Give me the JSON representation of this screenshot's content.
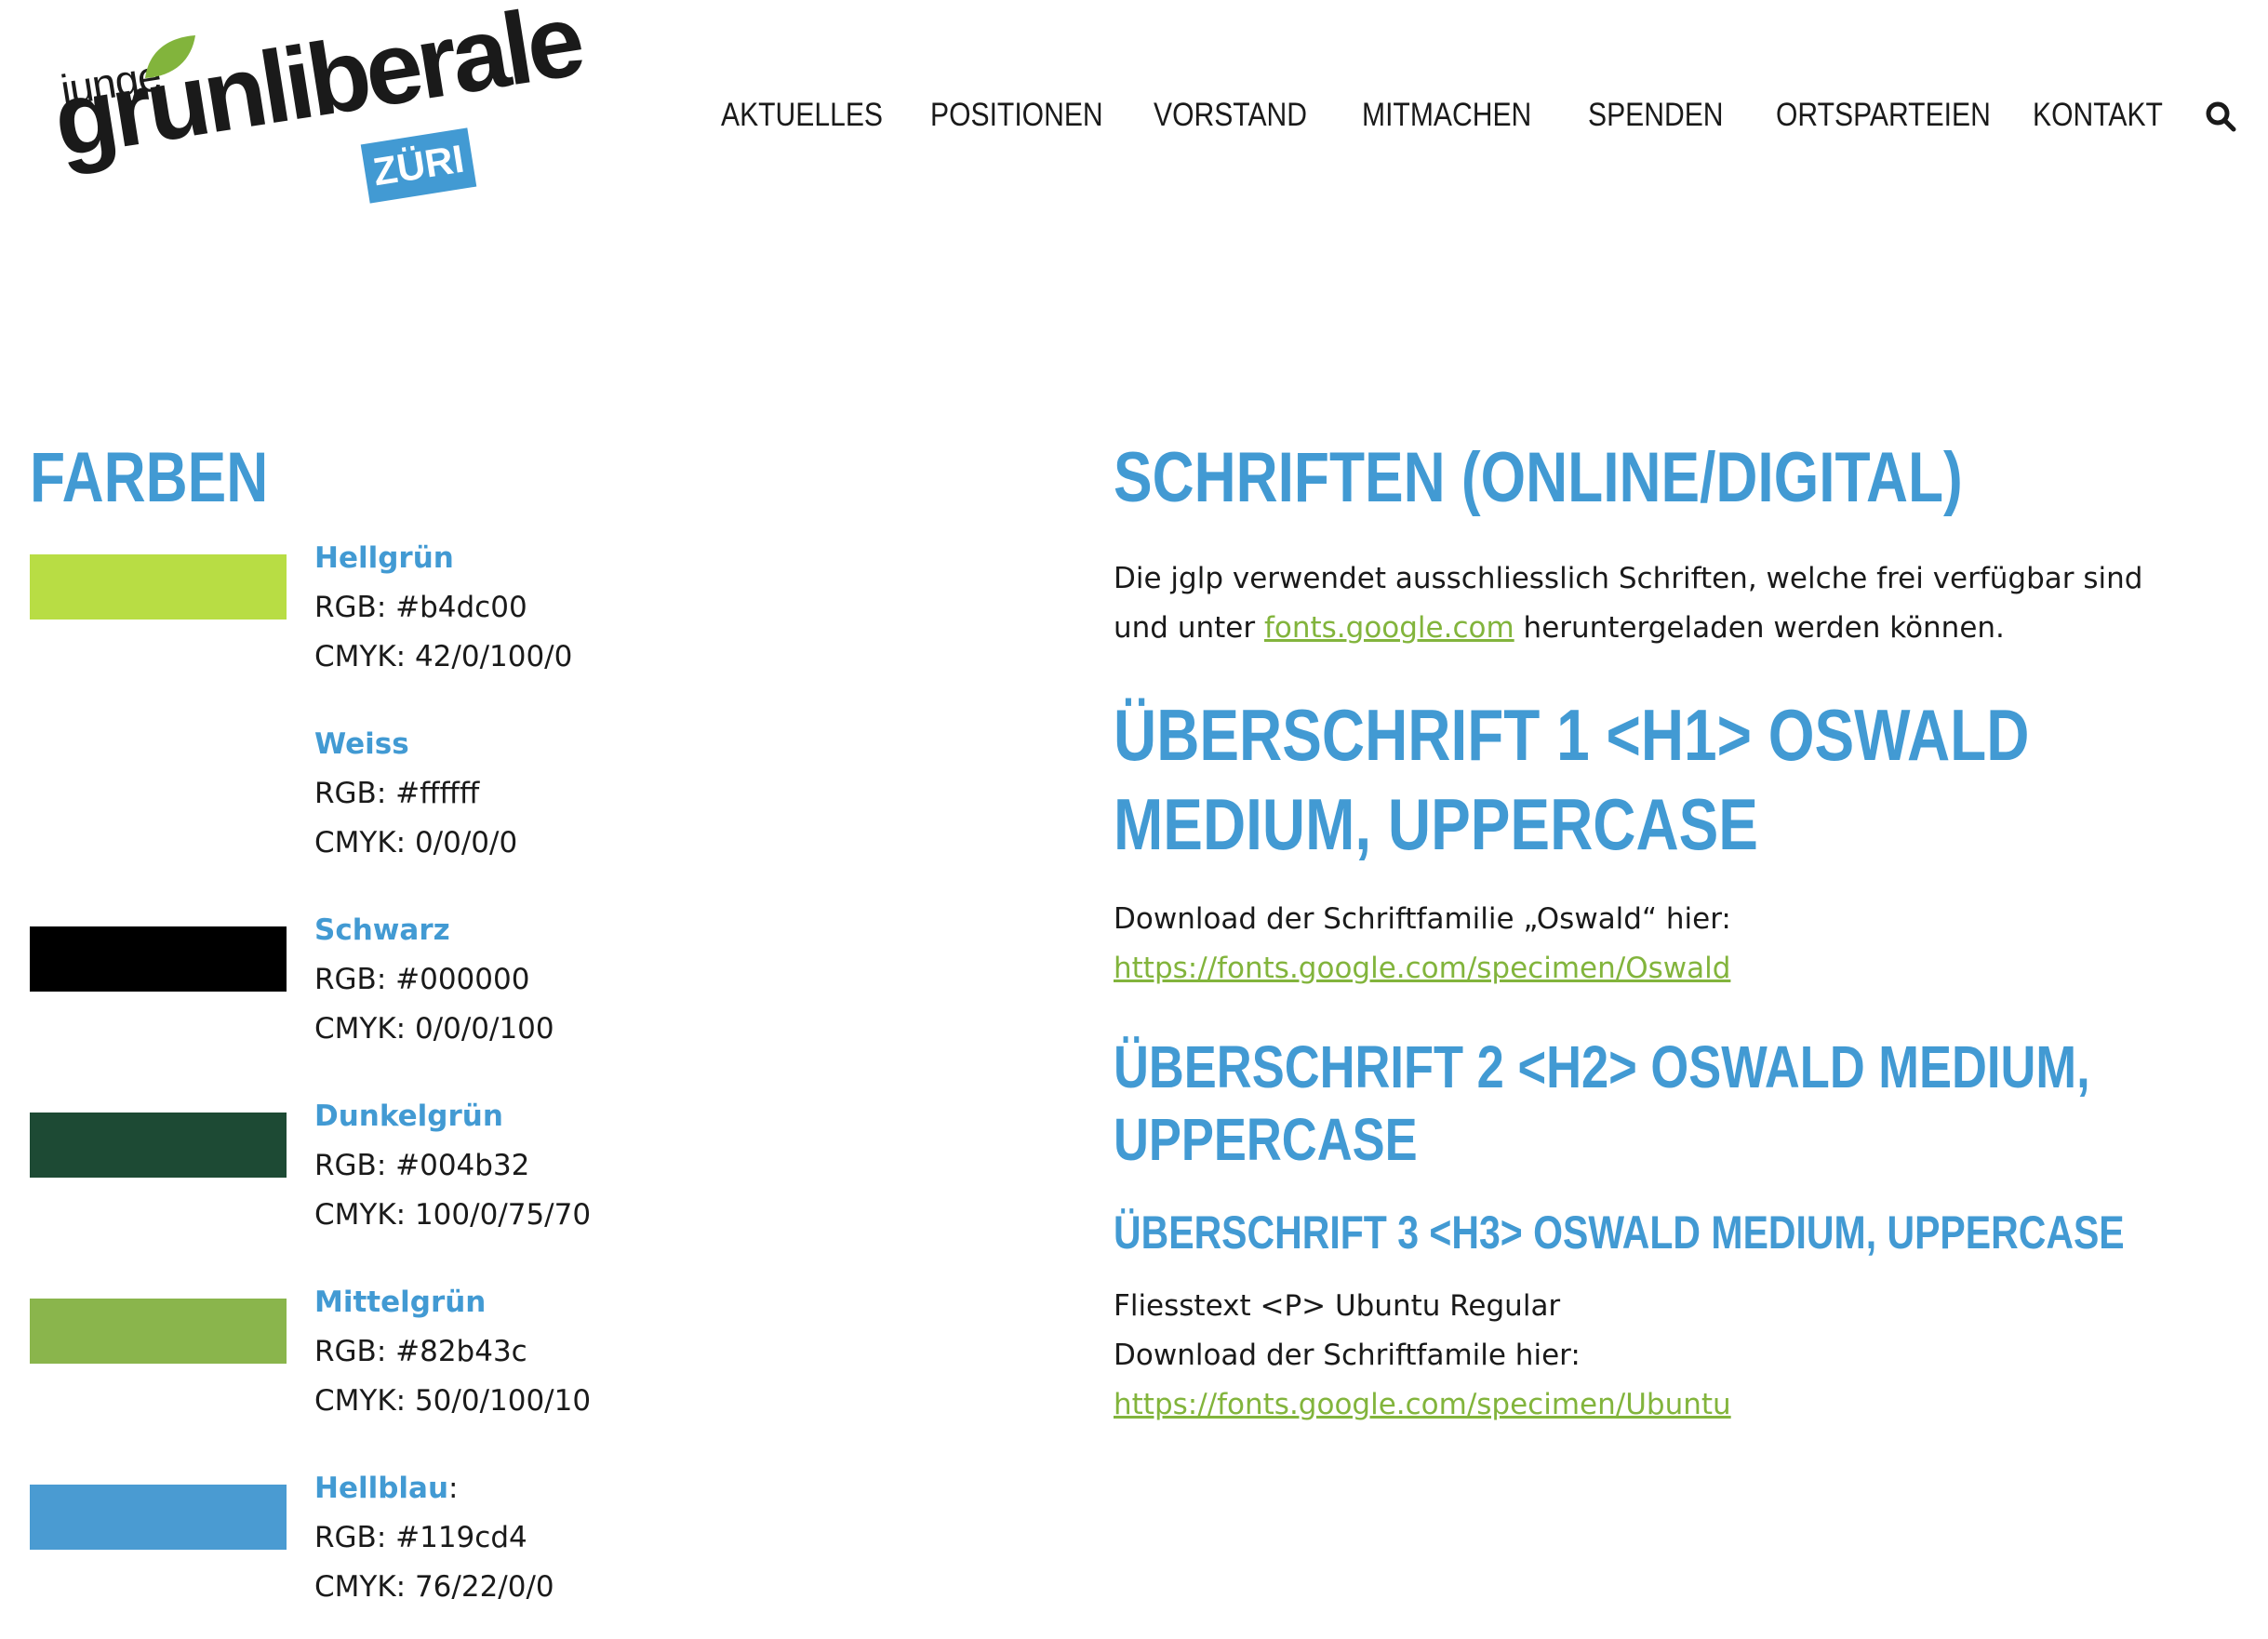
{
  "logo": {
    "junge": "junge",
    "main": "grunliberale",
    "badge": "ZÜRI",
    "colors": {
      "leaf": "#82b43c",
      "badge": "#429ad3",
      "text": "#1a1a1a"
    }
  },
  "nav": {
    "items": [
      "AKTUELLES",
      "POSITIONEN",
      "VORSTAND",
      "MITMACHEN",
      "SPENDEN",
      "ORTSPARTEIEN",
      "KONTAKT"
    ],
    "search_icon": "search-icon"
  },
  "farben": {
    "title": "FARBEN",
    "colors": [
      {
        "name": "Hellgrün",
        "suffix": "",
        "rgb": "RGB: #b4dc00",
        "cmyk": "CMYK: 42/0/100/0",
        "swatch": "#b8dd44",
        "show_swatch": true
      },
      {
        "name": "Weiss",
        "suffix": "",
        "rgb": "RGB: #ffffff",
        "cmyk": "CMYK: 0/0/0/0",
        "swatch": "#ffffff",
        "show_swatch": false
      },
      {
        "name": "Schwarz",
        "suffix": "",
        "rgb": "RGB: #000000",
        "cmyk": "CMYK: 0/0/0/100",
        "swatch": "#000000",
        "show_swatch": true
      },
      {
        "name": "Dunkelgrün",
        "suffix": "",
        "rgb": "RGB: #004b32",
        "cmyk": "CMYK: 100/0/75/70",
        "swatch": "#1d4a34",
        "show_swatch": true
      },
      {
        "name": "Mittelgrün",
        "suffix": "",
        "rgb": "RGB: #82b43c",
        "cmyk": "CMYK: 50/0/100/10",
        "swatch": "#8ab54c",
        "show_swatch": true
      },
      {
        "name": "Hellblau",
        "suffix": ":",
        "rgb": "RGB: #119cd4",
        "cmyk": "CMYK: 76/22/0/0",
        "swatch": "#4a9bd2",
        "show_swatch": true
      }
    ]
  },
  "schriften": {
    "title": "SCHRIFTEN (ONLINE/DIGITAL)",
    "intro_a": "Die jglp verwendet ausschliesslich Schriften, welche frei verfügbar sind und unter ",
    "intro_link": "fonts.google.com",
    "intro_b": " heruntergeladen werden können.",
    "h1_demo": "ÜBERSCHRIFT 1 <H1> OSWALD MEDIUM, UPPERCASE",
    "oswald_download": "Download der Schriftfamilie „Oswald“ hier:",
    "oswald_link": "https://fonts.google.com/specimen/Oswald",
    "h2_demo": "ÜBERSCHRIFT 2 <H2> OSWALD MEDIUM, UPPERCASE",
    "h3_demo": "ÜBERSCHRIFT 3 <H3> OSWALD MEDIUM, UPPERCASE",
    "p_demo": "Fliesstext <P> Ubuntu Regular",
    "ubuntu_download": "Download der Schriftfamile hier:",
    "ubuntu_link": "https://fonts.google.com/specimen/Ubuntu"
  },
  "theme": {
    "accent_blue": "#429ad3",
    "link_green": "#82b43c"
  }
}
